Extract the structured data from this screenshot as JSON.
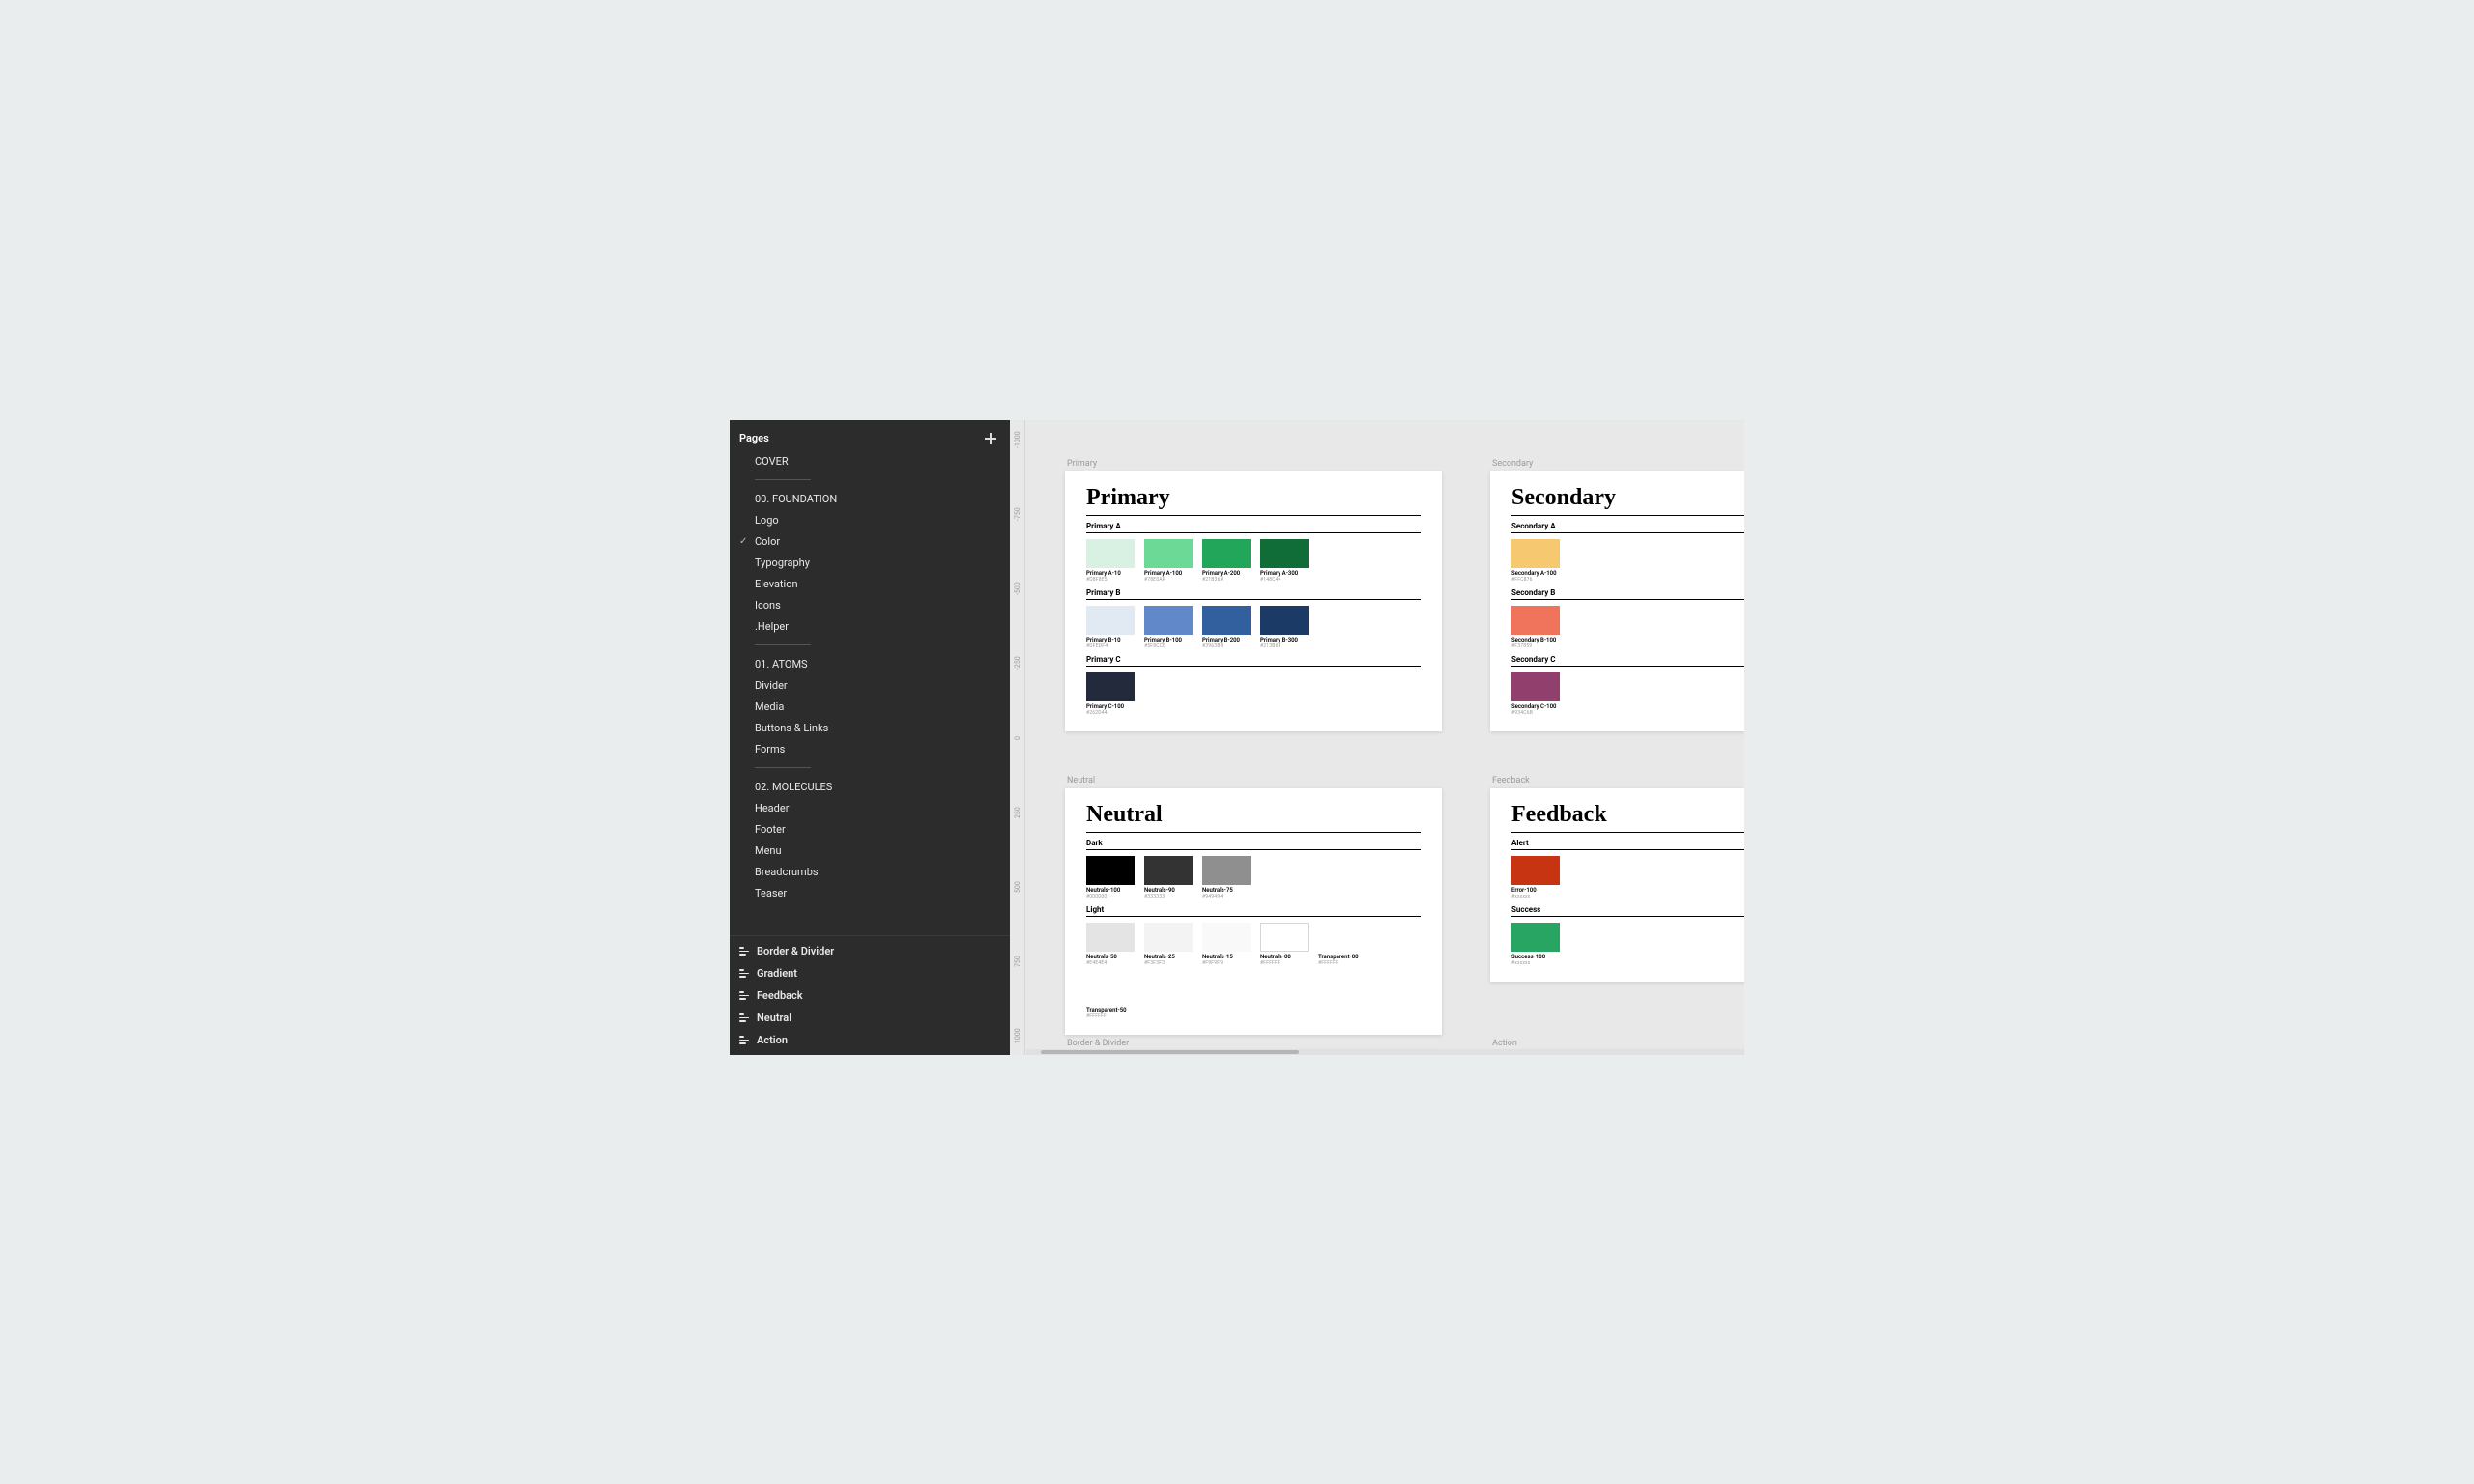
{
  "sidebar": {
    "pages_header": "Pages",
    "items": [
      {
        "label": "COVER",
        "type": "item"
      },
      {
        "type": "sep"
      },
      {
        "label": "00. FOUNDATION",
        "type": "item"
      },
      {
        "label": "Logo",
        "type": "item"
      },
      {
        "label": "Color",
        "type": "item",
        "selected": true
      },
      {
        "label": "Typography",
        "type": "item"
      },
      {
        "label": "Elevation",
        "type": "item"
      },
      {
        "label": "Icons",
        "type": "item"
      },
      {
        "label": ".Helper",
        "type": "item"
      },
      {
        "type": "sep"
      },
      {
        "label": "01. ATOMS",
        "type": "item"
      },
      {
        "label": "Divider",
        "type": "item"
      },
      {
        "label": "Media",
        "type": "item"
      },
      {
        "label": "Buttons & Links",
        "type": "item"
      },
      {
        "label": "Forms",
        "type": "item"
      },
      {
        "type": "sep"
      },
      {
        "label": "02. MOLECULES",
        "type": "item"
      },
      {
        "label": "Header",
        "type": "item"
      },
      {
        "label": "Footer",
        "type": "item"
      },
      {
        "label": "Menu",
        "type": "item"
      },
      {
        "label": "Breadcrumbs",
        "type": "item"
      },
      {
        "label": "Teaser",
        "type": "item"
      }
    ],
    "layers": [
      "Border & Divider",
      "Gradient",
      "Feedback",
      "Neutral",
      "Action"
    ]
  },
  "ruler": {
    "ticks": [
      "-1000",
      "-750",
      "-500",
      "-250",
      "0",
      "250",
      "500",
      "750",
      "1000"
    ]
  },
  "frames": {
    "primary": {
      "label": "Primary",
      "title": "Primary",
      "groups": [
        {
          "name": "Primary A",
          "swatches": [
            {
              "name": "Primary A-10",
              "hex": "#D8F8E5",
              "color": "#d8f1e3"
            },
            {
              "name": "Primary A-100",
              "hex": "#78E0AF",
              "color": "#6cd997"
            },
            {
              "name": "Primary A-200",
              "hex": "#21B36A",
              "color": "#22a65a"
            },
            {
              "name": "Primary A-300",
              "hex": "#148C44",
              "color": "#116d38"
            }
          ]
        },
        {
          "name": "Primary B",
          "swatches": [
            {
              "name": "Primary B-10",
              "hex": "#DFEDF4",
              "color": "#e1e9f3"
            },
            {
              "name": "Primary B-100",
              "hex": "#5F8CCB",
              "color": "#6189c9"
            },
            {
              "name": "Primary B-200",
              "hex": "#3963B9",
              "color": "#325f9e"
            },
            {
              "name": "Primary B-300",
              "hex": "#213B6F",
              "color": "#1c3a66"
            }
          ]
        },
        {
          "name": "Primary C",
          "swatches": [
            {
              "name": "Primary C-100",
              "hex": "#262D44",
              "color": "#222a3c"
            }
          ]
        }
      ]
    },
    "secondary": {
      "label": "Secondary",
      "title": "Secondary",
      "groups": [
        {
          "name": "Secondary A",
          "swatches": [
            {
              "name": "Secondary A-100",
              "hex": "#FFC876",
              "color": "#f6c970"
            }
          ]
        },
        {
          "name": "Secondary B",
          "swatches": [
            {
              "name": "Secondary B-100",
              "hex": "#F37859",
              "color": "#f0735b"
            }
          ]
        },
        {
          "name": "Secondary C",
          "swatches": [
            {
              "name": "Secondary C-100",
              "hex": "#934C6B",
              "color": "#913f6c"
            }
          ]
        }
      ]
    },
    "neutral": {
      "label": "Neutral",
      "title": "Neutral",
      "groups": [
        {
          "name": "Dark",
          "swatches": [
            {
              "name": "Neutrals-100",
              "hex": "#000000",
              "color": "#000000"
            },
            {
              "name": "Neutrals-90",
              "hex": "#333333",
              "color": "#333333"
            },
            {
              "name": "Neutrals-75",
              "hex": "#949494",
              "color": "#8f8f8f"
            }
          ]
        },
        {
          "name": "Light",
          "swatches": [
            {
              "name": "Neutrals-50",
              "hex": "#E4E4E4",
              "color": "#e4e4e4"
            },
            {
              "name": "Neutrals-25",
              "hex": "#F3F3F3",
              "color": "#f3f3f3"
            },
            {
              "name": "Neutrals-15",
              "hex": "#F9F9F9",
              "color": "#f9f9f9"
            },
            {
              "name": "Neutrals-00",
              "hex": "#FFFFFF",
              "color": "#ffffff",
              "outlined": true
            },
            {
              "name": "Transparent-00",
              "hex": "#FFFFFF",
              "nochip": true
            },
            {
              "name": "Transparent-50",
              "hex": "#FFFFFF",
              "nochip": true
            }
          ]
        }
      ]
    },
    "feedback": {
      "label": "Feedback",
      "title": "Feedback",
      "groups": [
        {
          "name": "Alert",
          "swatches": [
            {
              "name": "Error-100",
              "hex": "#xxxxxx",
              "color": "#c63412"
            }
          ]
        },
        {
          "name": "Success",
          "swatches": [
            {
              "name": "Success-100",
              "hex": "#xxxxxx",
              "color": "#28a562"
            }
          ]
        }
      ]
    },
    "border_divider": {
      "label": "Border & Divider"
    },
    "action": {
      "label": "Action"
    }
  },
  "scrollbar": {
    "left_pct": 2,
    "width_pct": 36
  }
}
